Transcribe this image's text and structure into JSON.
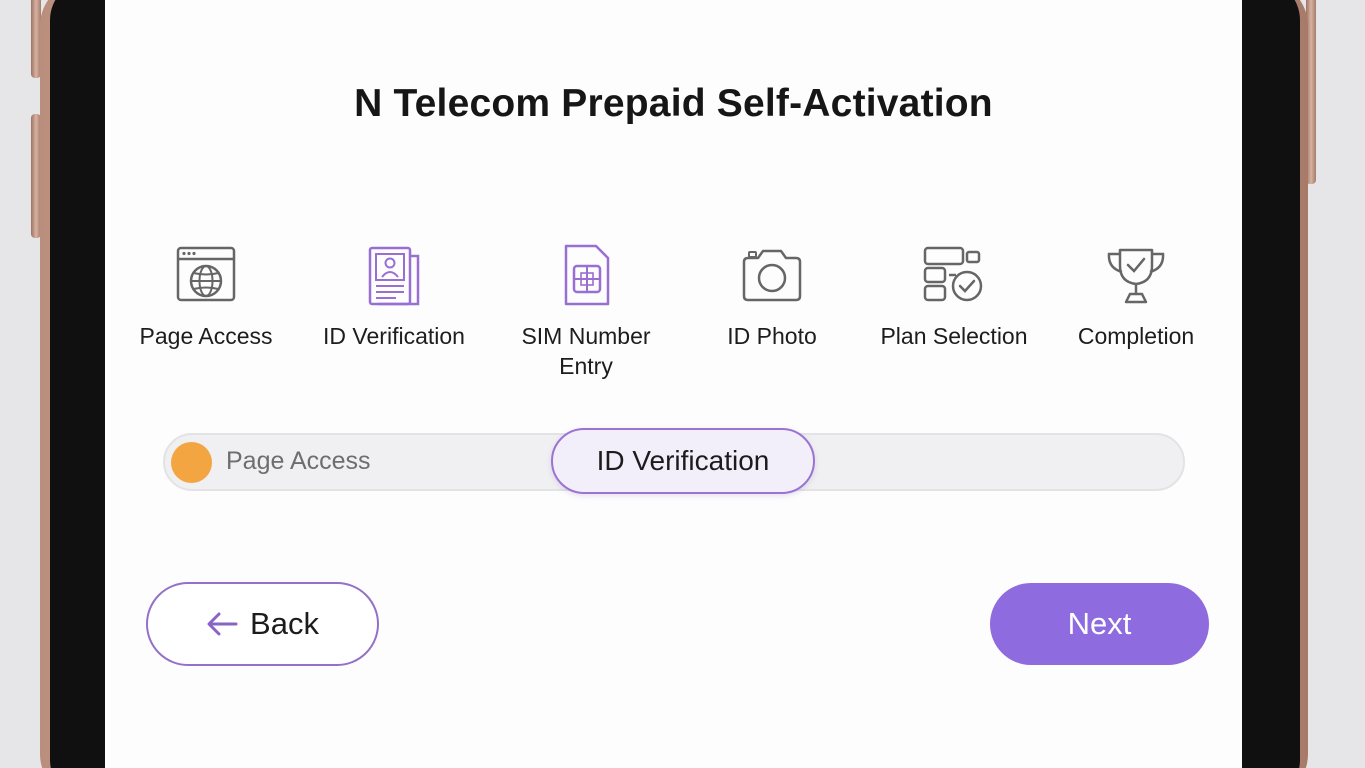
{
  "app": {
    "title": "N Telecom Prepaid Self-Activation"
  },
  "colors": {
    "accent": "#8e6bdf",
    "accent_border": "#9b73d3",
    "done_dot": "#f2a541",
    "icon_gray": "#6a6a6a",
    "icon_purple": "#9a6fd4"
  },
  "steps": [
    {
      "label": "Page Access",
      "icon": "browser-globe-icon"
    },
    {
      "label": "ID Verification",
      "icon": "id-card-icon"
    },
    {
      "label": "SIM Number\nEntry",
      "icon": "sim-card-icon"
    },
    {
      "label": "ID Photo",
      "icon": "camera-icon"
    },
    {
      "label": "Plan Selection",
      "icon": "plan-checklist-icon"
    },
    {
      "label": "Completion",
      "icon": "trophy-icon"
    }
  ],
  "progress": {
    "completed_label": "Page Access",
    "current_label": "ID Verification"
  },
  "nav": {
    "back_label": "Back",
    "next_label": "Next"
  }
}
